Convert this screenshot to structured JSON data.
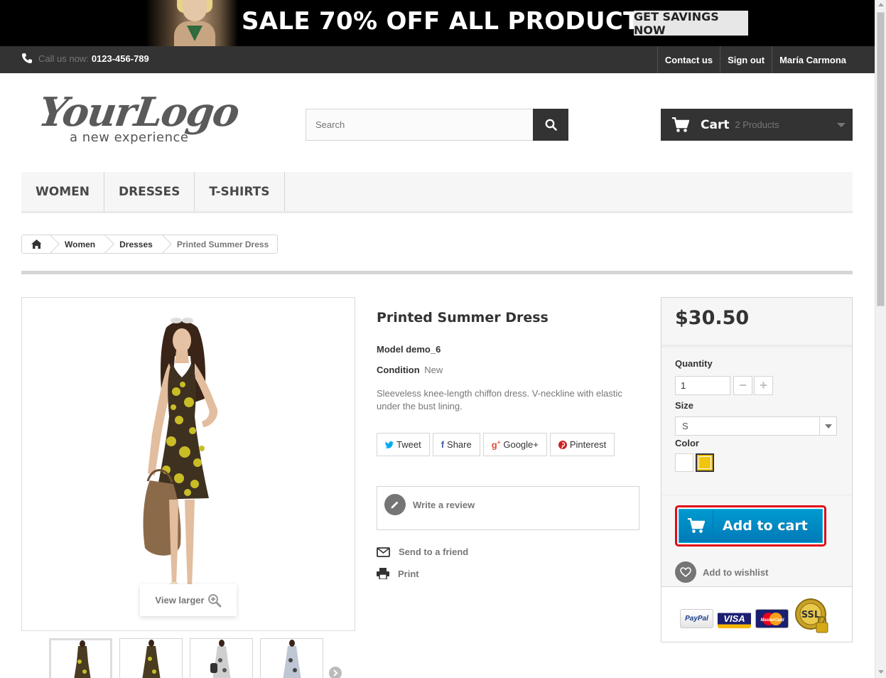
{
  "promo": {
    "headline": "SALE 70% OFF ALL PRODUCTS",
    "cta_label": "GET SAVINGS NOW"
  },
  "topbar": {
    "phone_prefix": "Call us now:",
    "phone_number": "0123-456-789",
    "links": [
      "Contact us",
      "Sign out",
      "María Carmona"
    ]
  },
  "logo": {
    "text": "YourLogo",
    "tagline": "a new experience"
  },
  "search": {
    "placeholder": "Search"
  },
  "cart": {
    "label": "Cart",
    "count": "2 Products"
  },
  "menu": [
    "Women",
    "Dresses",
    "T-shirts"
  ],
  "breadcrumb": {
    "items": [
      "Women",
      "Dresses"
    ],
    "current": "Printed Summer Dress"
  },
  "image": {
    "view_larger_label": "View larger"
  },
  "product": {
    "name": "Printed Summer Dress",
    "model_label": "Model",
    "model_value": "demo_6",
    "condition_label": "Condition",
    "condition_value": "New",
    "description": "Sleeveless knee-length chiffon dress. V-neckline with elastic under the bust lining."
  },
  "share": {
    "tweet": "Tweet",
    "share": "Share",
    "google": "Google+",
    "pinterest": "Pinterest"
  },
  "review": {
    "label": "Write a review"
  },
  "extras": {
    "send": "Send to a friend",
    "print": "Print"
  },
  "buybox": {
    "price": "$30.50",
    "quantity_label": "Quantity",
    "quantity_value": "1",
    "size_label": "Size",
    "size_value": "S",
    "color_label": "Color",
    "add_to_cart": "Add to cart",
    "wishlist": "Add to wishlist"
  },
  "payments": {
    "paypal": "PayPal",
    "visa": "VISA",
    "mastercard": "MasterCard",
    "ssl": "SSL"
  },
  "colors": {
    "dark": "#333333",
    "accent_blue": "#009ad0",
    "highlight_red": "#e10915",
    "swatch_yellow": "#f1c40f"
  }
}
